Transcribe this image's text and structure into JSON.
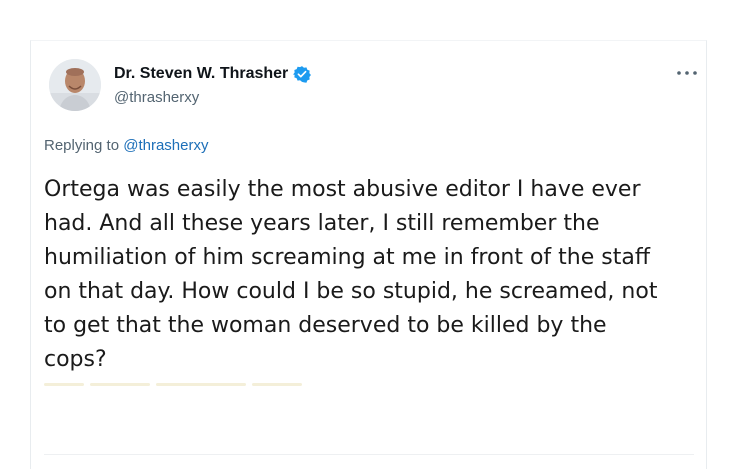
{
  "author": {
    "display_name": "Dr. Steven W. Thrasher",
    "handle": "@thrasherxy",
    "verified": true,
    "avatar_icon": "profile-photo-icon"
  },
  "reply": {
    "prefix": "Replying to ",
    "mention": "@thrasherxy"
  },
  "tweet": {
    "text_lines": [
      "Ortega was easily the most abusive editor I have ever",
      "had. And all these years later, I still remember the",
      "humiliation of him screaming at me in front of the staff",
      "on that day. How could I be so stupid, he screamed, not",
      "to get that the woman deserved to be killed by the",
      "cops?"
    ]
  },
  "menu": {
    "more_icon": "more-horizontal-icon"
  },
  "colors": {
    "verified_blue": "#1d9bf0",
    "mention_blue": "#1d6fb8",
    "text_primary": "#0f1419",
    "text_secondary": "#536471"
  }
}
